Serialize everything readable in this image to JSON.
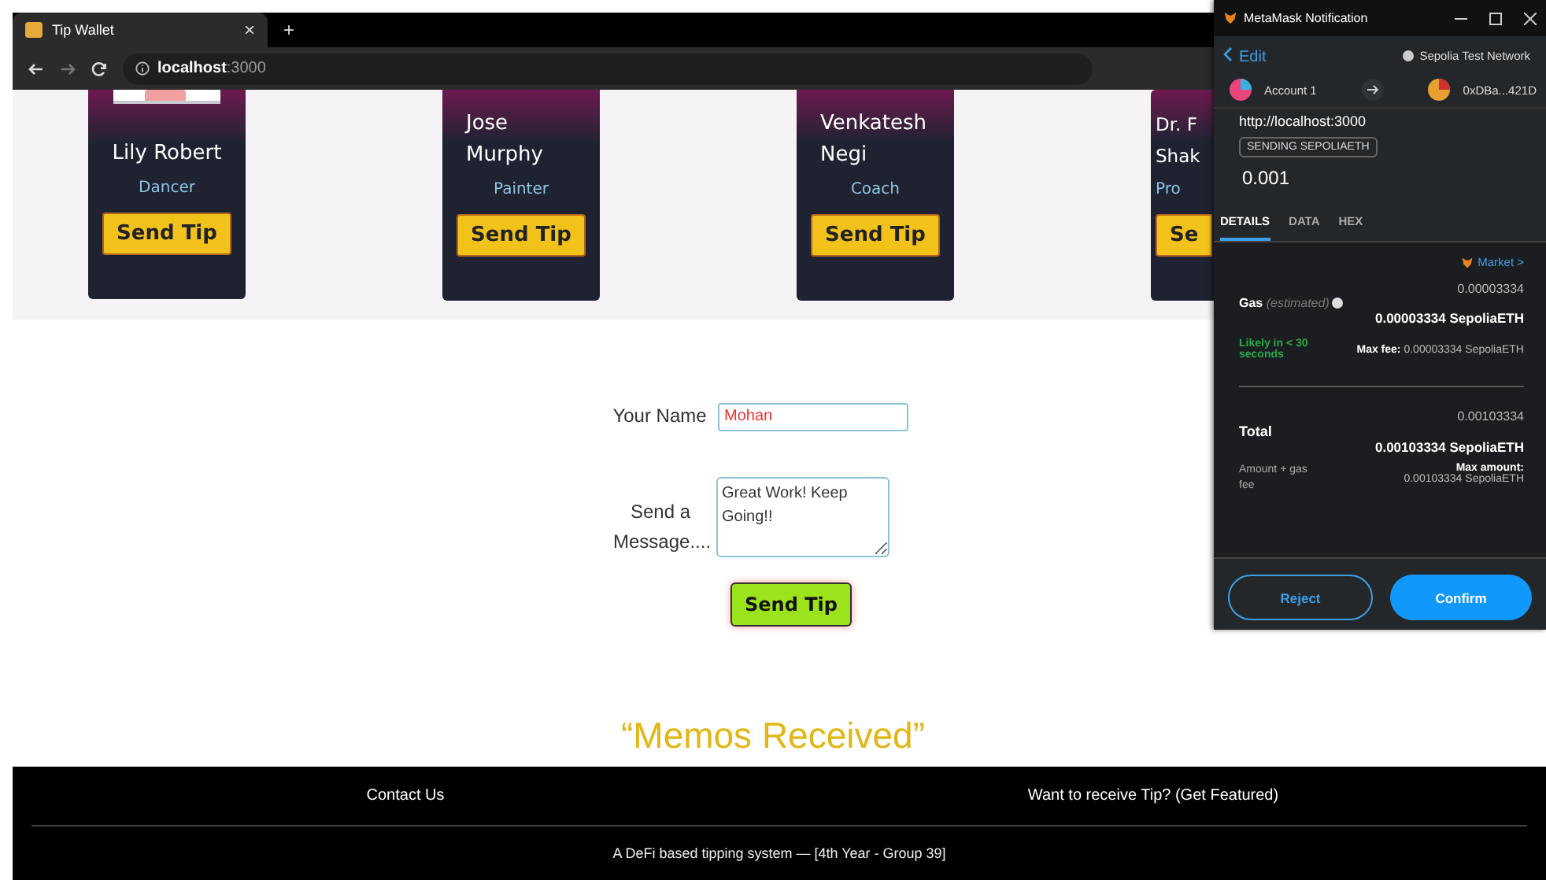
{
  "browser": {
    "tab_title": "Tip Wallet",
    "close": "×",
    "new_tab": "+",
    "address": "**localhost**:3000"
  },
  "cards": [
    {
      "kind": "full",
      "photo": true,
      "name_lines": [
        "Lily Robert"
      ],
      "role": "Dancer",
      "button": "Send Tip"
    },
    {
      "kind": "full",
      "photo": false,
      "name_lines": [
        "Jose",
        "Murphy"
      ],
      "role": "Painter",
      "button": "Send Tip"
    },
    {
      "kind": "full",
      "photo": false,
      "name_lines": [
        "Venkatesh",
        "Negi"
      ],
      "role": "Coach",
      "button": "Send Tip"
    },
    {
      "kind": "partial",
      "photo": false,
      "name_lines": [
        "Dr. F",
        "Shak"
      ],
      "role": "Pro",
      "button": "Se"
    }
  ],
  "form": {
    "name_label": "Your Name",
    "name_value": "Mohan",
    "message_label": "Send a Message....",
    "message_value": "Great Work! Keep Going!!",
    "button": "Send Tip"
  },
  "memos_title": "“Memos Received”",
  "footer": {
    "links": [
      "Contact Us",
      "Want to receive Tip? (Get Featured)"
    ],
    "note": "A DeFi based tipping system — [4th Year - Group 39]"
  },
  "metamask": {
    "title": "MetaMask Notification",
    "back": "Edit",
    "network": "Sepolia Test Network",
    "from": "Account 1",
    "to": "0xDBa...421D",
    "origin": "http://localhost:3000",
    "tag": "SENDING SEPOLIAETH",
    "amount": "0.001",
    "tabs": [
      {
        "label": "DETAILS",
        "selected": true
      },
      {
        "label": "DATA",
        "selected": false
      },
      {
        "label": "HEX",
        "selected": false
      }
    ],
    "market": "Market >",
    "gas": {
      "label": "Gas",
      "note": "(estimated)",
      "small": "0.00003334",
      "big": "0.00003334 SepoliaETH",
      "eta": "Likely in < 30 seconds",
      "max_fee": "**Max fee:** 0.00003334 SepoliaETH"
    },
    "total": {
      "label": "Total",
      "small": "0.00103334",
      "big": "0.00103334 SepoliaETH",
      "sub": "Amount + gas fee",
      "max_label": "Max amount:",
      "max_value": "0.00103334 SepoliaETH"
    },
    "buttons": [
      "Reject",
      "Confirm"
    ]
  }
}
